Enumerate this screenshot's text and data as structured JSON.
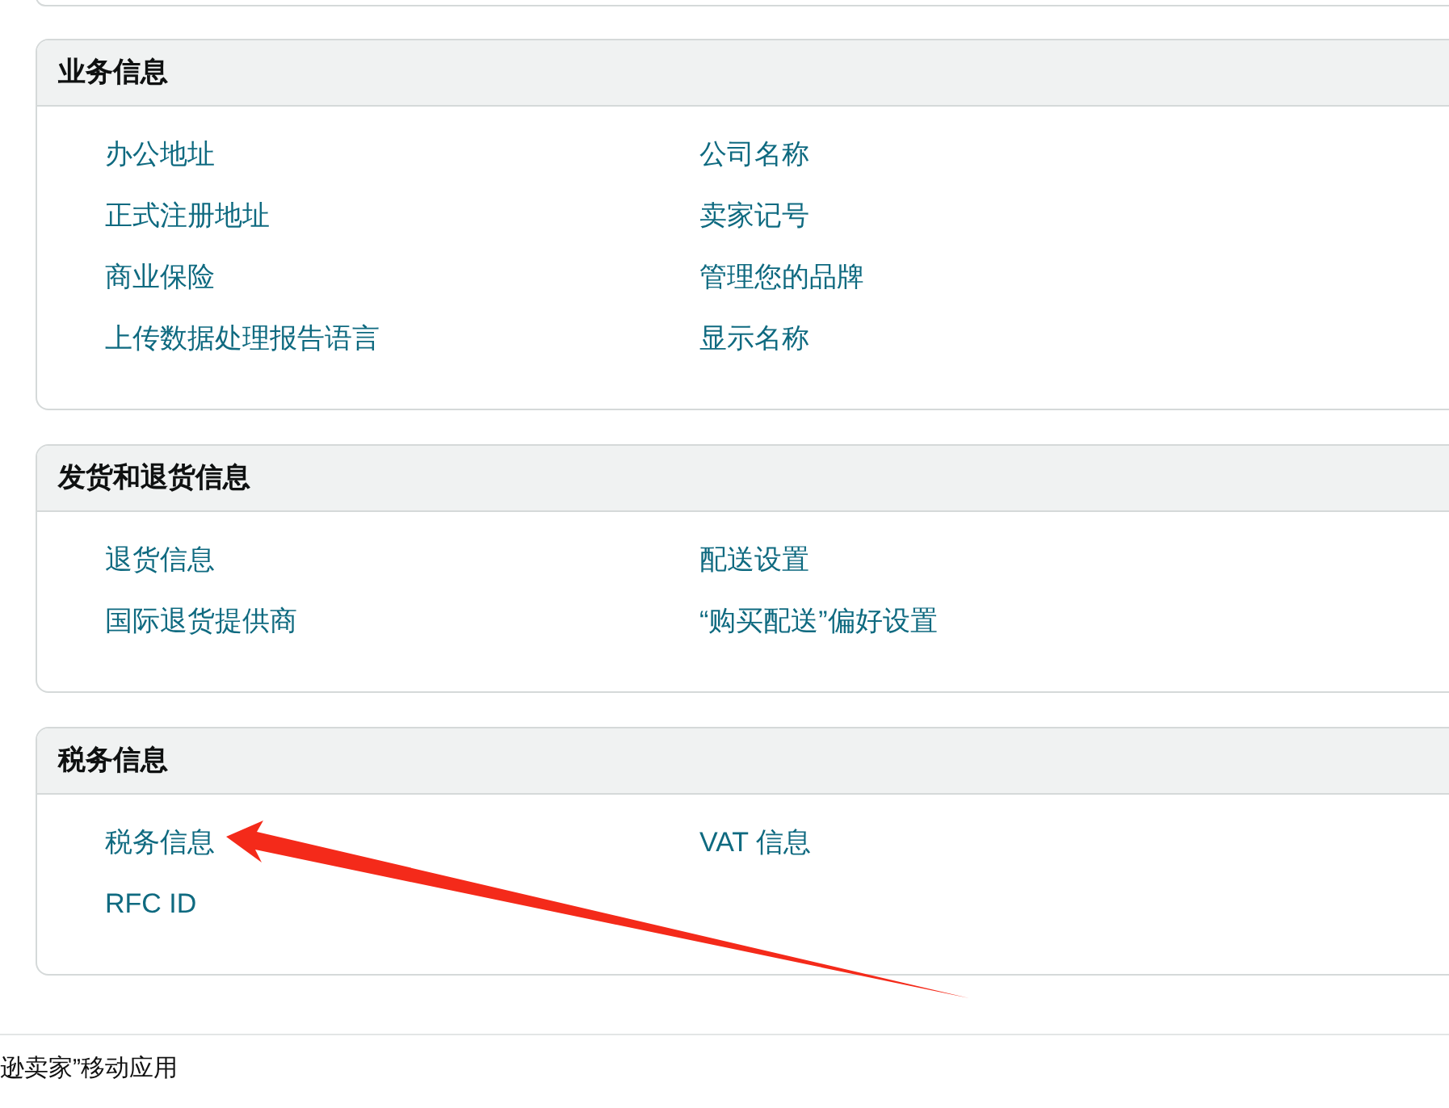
{
  "sections": [
    {
      "title": "业务信息",
      "links": [
        "办公地址",
        "公司名称",
        "正式注册地址",
        "卖家记号",
        "商业保险",
        "管理您的品牌",
        "上传数据处理报告语言",
        "显示名称"
      ]
    },
    {
      "title": "发货和退货信息",
      "links": [
        "退货信息",
        "配送设置",
        "国际退货提供商",
        "“购买配送”偏好设置"
      ]
    },
    {
      "title": "税务信息",
      "links": [
        "税务信息",
        "VAT 信息",
        "RFC ID"
      ]
    }
  ],
  "footer": {
    "text": "逊卖家”移动应用"
  }
}
